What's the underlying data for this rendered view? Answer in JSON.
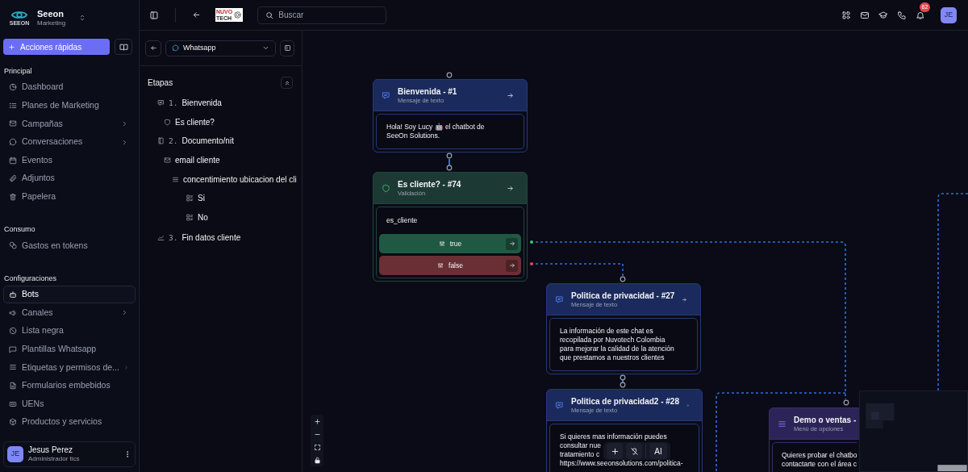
{
  "sidebar": {
    "brand": {
      "logo_text": "SEEON",
      "name": "Seeon",
      "subtitle": "Marketing"
    },
    "quick_action": {
      "label": "Acciones rápidas"
    },
    "sections": [
      {
        "title": "Principal",
        "items": [
          {
            "label": "Dashboard",
            "kind": "pie",
            "has_submenu": false,
            "selected": false
          },
          {
            "label": "Planes de Marketing",
            "kind": "list",
            "has_submenu": false,
            "selected": false
          },
          {
            "label": "Campañas",
            "kind": "mail",
            "has_submenu": true,
            "selected": false
          },
          {
            "label": "Conversaciones",
            "kind": "chat",
            "has_submenu": true,
            "selected": false
          },
          {
            "label": "Eventos",
            "kind": "calendar",
            "has_submenu": false,
            "selected": false
          },
          {
            "label": "Adjuntos",
            "kind": "clip",
            "has_submenu": false,
            "selected": false
          },
          {
            "label": "Papelera",
            "kind": "trash",
            "has_submenu": false,
            "selected": false
          }
        ]
      },
      {
        "title": "Consumo",
        "items": [
          {
            "label": "Gastos en tokens",
            "kind": "coins",
            "has_submenu": false,
            "selected": false
          }
        ]
      },
      {
        "title": "Configuraciones",
        "items": [
          {
            "label": "Bots",
            "kind": "bot",
            "has_submenu": false,
            "selected": true
          },
          {
            "label": "Canales",
            "kind": "megaphone",
            "has_submenu": true,
            "selected": false
          },
          {
            "label": "Lista negra",
            "kind": "ban",
            "has_submenu": false,
            "selected": false
          },
          {
            "label": "Plantillas Whatsapp",
            "kind": "message",
            "has_submenu": false,
            "selected": false
          },
          {
            "label": "Etiquetas y permisos de...",
            "kind": "lines",
            "has_submenu": true,
            "selected": false
          },
          {
            "label": "Formularios embebidos",
            "kind": "file",
            "has_submenu": false,
            "selected": false
          },
          {
            "label": "UENs",
            "kind": "id",
            "has_submenu": false,
            "selected": false
          },
          {
            "label": "Productos y servicios",
            "kind": "box",
            "has_submenu": false,
            "selected": false
          }
        ]
      }
    ],
    "user": {
      "initials": "JE",
      "name": "Jesus Perez",
      "role": "Administrador tics"
    }
  },
  "topbar": {
    "org_logo": {
      "line1": "NUVO",
      "line2": "TECH"
    },
    "search": {
      "placeholder": "Buscar"
    },
    "notifications": "62",
    "avatar": "JE"
  },
  "flow_panel": {
    "channel": "Whatsapp",
    "title": "Etapas",
    "stages": [
      {
        "number": "1.",
        "label": "Bienvenida",
        "kind": "message",
        "children": [
          {
            "label": "Es cliente?",
            "kind": "validation"
          }
        ]
      },
      {
        "number": "2.",
        "label": "Documento/nit",
        "kind": "document",
        "children": [
          {
            "label": "email cliente",
            "kind": "email",
            "children": [
              {
                "label": "concentimiento ubicacion del cli",
                "kind": "menu",
                "children": [
                  {
                    "label": "Si",
                    "kind": "option"
                  },
                  {
                    "label": "No",
                    "kind": "option"
                  }
                ]
              }
            ]
          }
        ]
      },
      {
        "number": "3.",
        "label": "Fin datos cliente",
        "kind": "end"
      }
    ]
  },
  "canvas": {
    "nodes": [
      {
        "kind": "message",
        "title": "Bienvenida - #1",
        "subtitle": "Mensaje de texto",
        "lines": [
          "Hola! Soy Lucy 🤖 el chatbot de",
          "SeeOn Solutions."
        ]
      },
      {
        "kind": "validation",
        "title": "Es cliente? - #74",
        "subtitle": "Validación",
        "lines": [
          "es_cliente"
        ],
        "options": [
          {
            "label": "true",
            "kind": "true"
          },
          {
            "label": "false",
            "kind": "false"
          }
        ]
      },
      {
        "kind": "message",
        "title": "Politica de privacidad - #27",
        "subtitle": "Mensaje de texto",
        "lines": [
          "La información de este chat es",
          "recopilada por Nuvotech Colombia",
          "para mejorar la calidad de la atención",
          "que prestamos a nuestros clientes"
        ]
      },
      {
        "kind": "message",
        "title": "Politica de privacidad2 - #28",
        "subtitle": "Mensaje de texto",
        "lines": [
          "Si quieres mas información puedes",
          "consultar nue",
          "tratamiento c",
          "https://www.seeonsolutions.com/politica-"
        ]
      },
      {
        "kind": "menu",
        "title": "Demo o ventas -",
        "subtitle": "Menú de opciones",
        "lines": [
          "Quieres probar el chatbo",
          "contactarte con el área c"
        ]
      }
    ],
    "toolbar": {
      "ai_label": "AI"
    }
  }
}
